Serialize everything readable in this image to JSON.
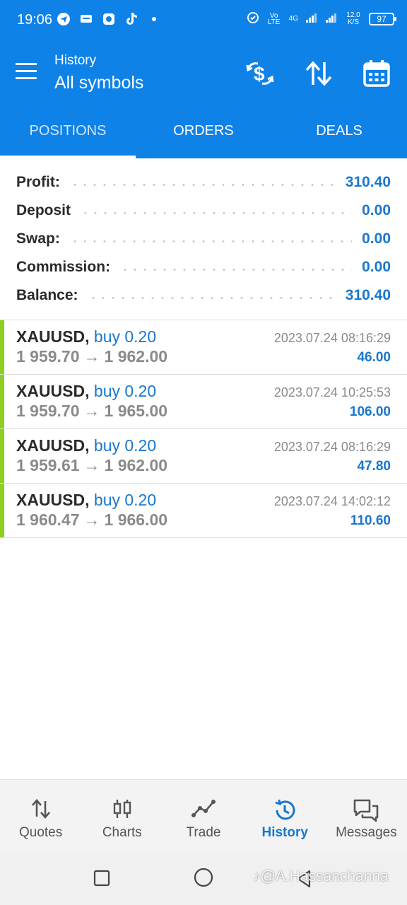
{
  "status_bar": {
    "time": "19:06",
    "net_type": "Vo LTE",
    "signal": "4G",
    "speed": "12.0 K/S",
    "battery": "97"
  },
  "app_bar": {
    "subtitle": "History",
    "title": "All symbols"
  },
  "tabs": [
    {
      "label": "POSITIONS",
      "active": true
    },
    {
      "label": "ORDERS",
      "active": false
    },
    {
      "label": "DEALS",
      "active": false
    }
  ],
  "summary": [
    {
      "label": "Profit:",
      "value": "310.40"
    },
    {
      "label": "Deposit",
      "value": "0.00"
    },
    {
      "label": "Swap:",
      "value": "0.00"
    },
    {
      "label": "Commission:",
      "value": "0.00"
    },
    {
      "label": "Balance:",
      "value": "310.40"
    }
  ],
  "positions": [
    {
      "symbol": "XAUUSD,",
      "side": "buy 0.20",
      "open": "1 959.70",
      "arrow": "→",
      "close": "1 962.00",
      "time": "2023.07.24 08:16:29",
      "profit": "46.00"
    },
    {
      "symbol": "XAUUSD,",
      "side": "buy 0.20",
      "open": "1 959.70",
      "arrow": "→",
      "close": "1 965.00",
      "time": "2023.07.24 10:25:53",
      "profit": "106.00"
    },
    {
      "symbol": "XAUUSD,",
      "side": "buy 0.20",
      "open": "1 959.61",
      "arrow": "→",
      "close": "1 962.00",
      "time": "2023.07.24 08:16:29",
      "profit": "47.80"
    },
    {
      "symbol": "XAUUSD,",
      "side": "buy 0.20",
      "open": "1 960.47",
      "arrow": "→",
      "close": "1 966.00",
      "time": "2023.07.24 14:02:12",
      "profit": "110.60"
    }
  ],
  "bottom_nav": [
    {
      "label": "Quotes",
      "icon": "quotes-icon"
    },
    {
      "label": "Charts",
      "icon": "charts-icon"
    },
    {
      "label": "Trade",
      "icon": "trade-icon"
    },
    {
      "label": "History",
      "icon": "history-icon",
      "active": true
    },
    {
      "label": "Messages",
      "icon": "messages-icon"
    }
  ],
  "watermark": "@A.Hassanchanna",
  "colors": {
    "primary": "#0f82e8",
    "value_blue": "#1877cf",
    "buy_bar": "#8ccf1e"
  }
}
